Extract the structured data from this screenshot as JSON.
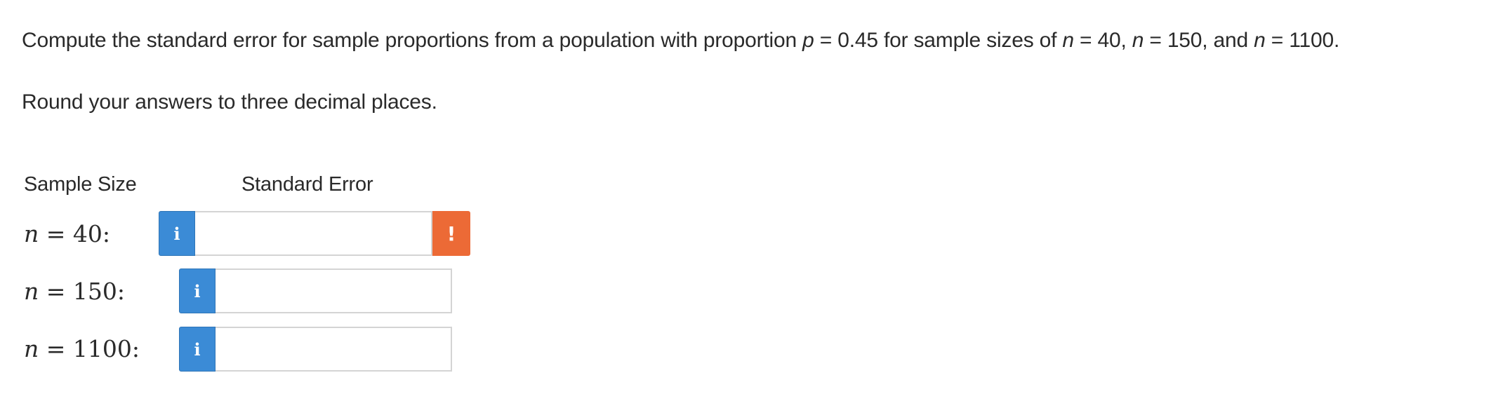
{
  "question": {
    "prefix": "Compute the standard error for sample proportions from a population with proportion ",
    "p_var": "p",
    "p_eq": " = 0.45 for sample sizes of ",
    "n1_var": "n",
    "n1_eq": " = 40, ",
    "n2_var": "n",
    "n2_eq": " = 150, and ",
    "n3_var": "n",
    "n3_eq": " = 1100.",
    "instruction": "Round your answers to three decimal places."
  },
  "table": {
    "header_sample_size": "Sample Size",
    "header_standard_error": "Standard Error",
    "rows": [
      {
        "var": "n",
        "rest": " = 40:",
        "info_icon": "i",
        "value": "",
        "warning": "!"
      },
      {
        "var": "n",
        "rest": " = 150:",
        "info_icon": "i",
        "value": ""
      },
      {
        "var": "n",
        "rest": " = 1100:",
        "info_icon": "i",
        "value": ""
      }
    ]
  },
  "colors": {
    "info_blue": "#3b8bd6",
    "warning_orange": "#ec6a36",
    "text": "#2a2a2a",
    "input_border": "#d4d4d4"
  },
  "icons": {
    "info": "info-icon",
    "warning": "exclamation-icon"
  }
}
